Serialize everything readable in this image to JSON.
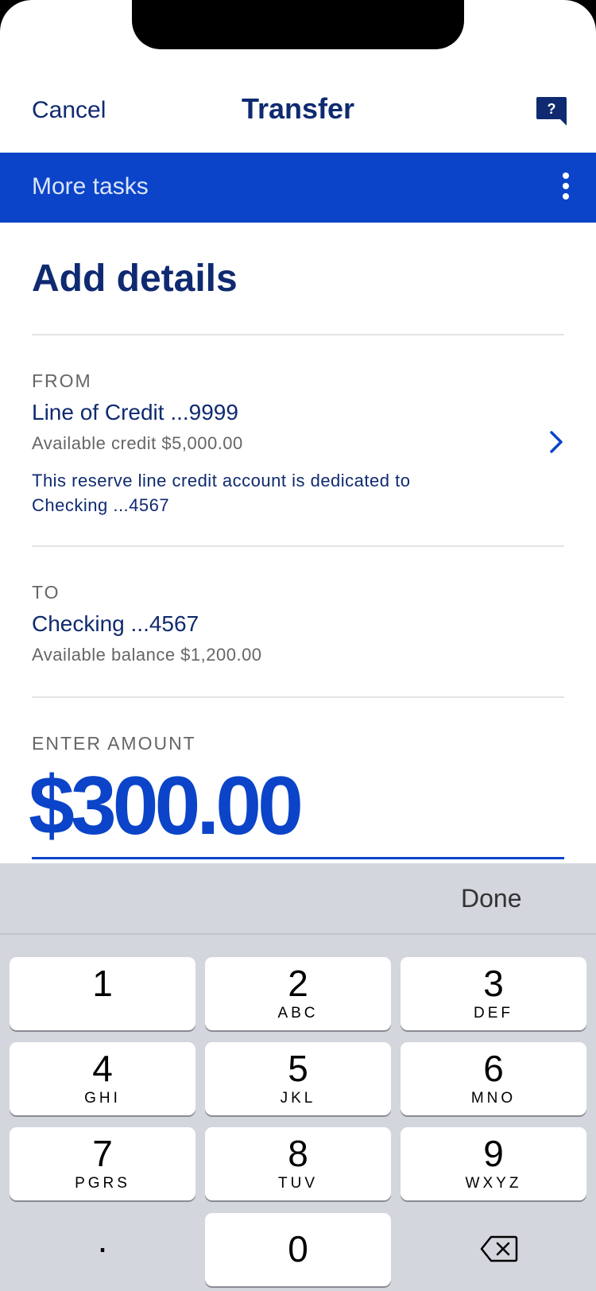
{
  "header": {
    "cancel_label": "Cancel",
    "title": "Transfer",
    "help_icon_text": "?"
  },
  "more_tasks": {
    "label": "More tasks"
  },
  "page": {
    "heading": "Add details"
  },
  "from": {
    "caption": "FROM",
    "account": "Line of Credit ...9999",
    "available": "Available credit $5,000.00",
    "note_line1": "This reserve line credit account is dedicated to",
    "note_line2": "Checking ...4567"
  },
  "to": {
    "caption": "TO",
    "account": "Checking ...4567",
    "available": "Available balance $1,200.00"
  },
  "amount": {
    "caption": "ENTER AMOUNT",
    "value": "$300.00"
  },
  "keyboard": {
    "done_label": "Done",
    "keys": [
      {
        "num": "1",
        "letters": ""
      },
      {
        "num": "2",
        "letters": "ABC"
      },
      {
        "num": "3",
        "letters": "DEF"
      },
      {
        "num": "4",
        "letters": "GHI"
      },
      {
        "num": "5",
        "letters": "JKL"
      },
      {
        "num": "6",
        "letters": "MNO"
      },
      {
        "num": "7",
        "letters": "PGRS"
      },
      {
        "num": "8",
        "letters": "TUV"
      },
      {
        "num": "9",
        "letters": "WXYZ"
      },
      {
        "num": "0",
        "letters": ""
      }
    ],
    "dot_label": "."
  },
  "colors": {
    "brand_blue": "#0b44c8",
    "navy": "#0f2a70",
    "keyboard_bg": "#d3d6dc"
  }
}
